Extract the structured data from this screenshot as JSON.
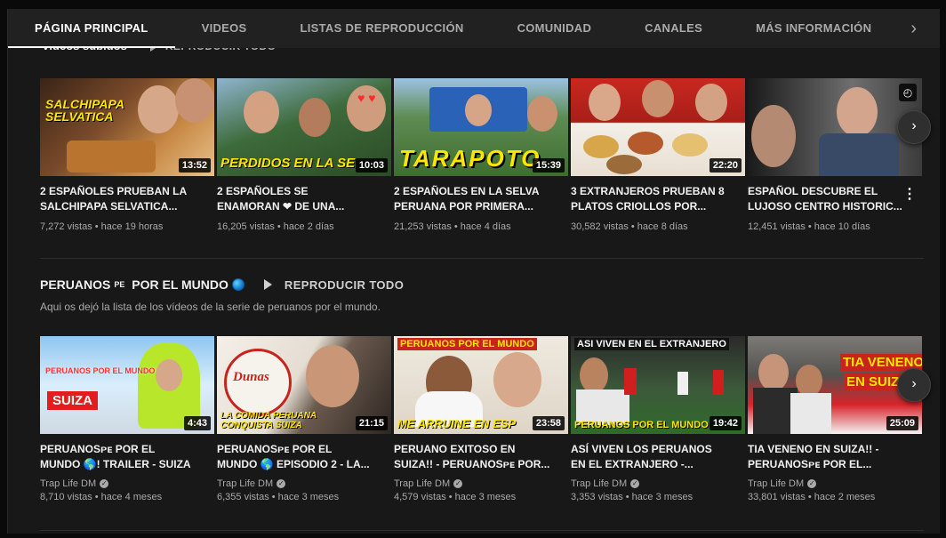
{
  "tabs": [
    {
      "label": "PÁGINA PRINCIPAL",
      "active": true
    },
    {
      "label": "VIDEOS"
    },
    {
      "label": "LISTAS DE REPRODUCCIÓN"
    },
    {
      "label": "COMUNIDAD"
    },
    {
      "label": "CANALES"
    },
    {
      "label": "MÁS INFORMACIÓN"
    }
  ],
  "tabs_next_icon": "chevron-right-icon",
  "section1": {
    "title": "Videos subidos",
    "play_all": "REPRODUCIR TODO",
    "videos": [
      {
        "title_line1": "2 ESPAÑOLES PRUEBAN LA",
        "title_line2": "SALCHIPAPA SELVATICA...",
        "meta": "7,272 vistas • hace 19 horas",
        "duration": "13:52",
        "overlay": "SALCHIPAPA SELVATICA"
      },
      {
        "title_line1": "2 ESPAÑOLES SE",
        "title_line2": "ENAMORAN ❤ DE UNA...",
        "meta": "16,205 vistas • hace 2 días",
        "duration": "10:03",
        "overlay": "PERDIDOS EN LA SE"
      },
      {
        "title_line1": "2 ESPAÑOLES EN LA SELVA",
        "title_line2": "PERUANA POR PRIMERA...",
        "meta": "21,253 vistas • hace 4 días",
        "duration": "15:39",
        "overlay": "TARAPOTO"
      },
      {
        "title_line1": "3 EXTRANJEROS PRUEBAN 8",
        "title_line2": "PLATOS CRIOLLOS POR...",
        "meta": "30,582 vistas • hace 8 días",
        "duration": "22:20",
        "overlay": ""
      },
      {
        "title_line1": "ESPAÑOL DESCUBRE EL",
        "title_line2": "LUJOSO CENTRO HISTORIC...",
        "meta": "12,451 vistas • hace 10 días",
        "duration": "",
        "overlay": ""
      }
    ]
  },
  "section2": {
    "title_main": "PERUANOS",
    "title_small": "PE",
    "title_rest": " POR EL MUNDO",
    "play_all": "REPRODUCIR TODO",
    "description": "Aqui os dejó la lista de los vídeos de la serie de peruanos por el mundo.",
    "videos": [
      {
        "title_line1": "PERUANOSᴘᴇ POR EL",
        "title_line2": "MUNDO 🌎! TRAILER - SUIZA",
        "channel": "Trap Life DM",
        "meta": "8,710 vistas • hace 4 meses",
        "duration": "4:43",
        "overlay1": "PERUANOS POR EL MUNDO",
        "overlay2": "SUIZA"
      },
      {
        "title_line1": "PERUANOSᴘᴇ POR EL",
        "title_line2": "MUNDO 🌎 EPISODIO 2 - LA...",
        "channel": "Trap Life DM",
        "meta": "6,355 vistas • hace 3 meses",
        "duration": "21:15",
        "overlay1": "Dunas",
        "overlay2": "LA COMIDA PERUANA CONQUISTA SUIZA"
      },
      {
        "title_line1": "PERUANO EXITOSO EN",
        "title_line2": "SUIZA!! - PERUANOSᴘᴇ POR...",
        "channel": "Trap Life DM",
        "meta": "4,579 vistas • hace 3 meses",
        "duration": "23:58",
        "overlay1": "PERUANOS POR EL MUNDO",
        "overlay2": "ME ARRUINE EN ESP"
      },
      {
        "title_line1": "ASÍ VIVEN LOS PERUANOS",
        "title_line2": "EN EL EXTRANJERO -...",
        "channel": "Trap Life DM",
        "meta": "3,353 vistas • hace 3 meses",
        "duration": "19:42",
        "overlay1": "ASI VIVEN EN EL EXTRANJERO",
        "overlay2": "PERUANOS POR EL MUNDO"
      },
      {
        "title_line1": "TIA VENENO EN SUIZA!! -",
        "title_line2": "PERUANOSᴘᴇ POR EL...",
        "channel": "Trap Life DM",
        "meta": "33,801 vistas • hace 2 meses",
        "duration": "25:09",
        "overlay1": "TIA VENENO",
        "overlay2": "EN SUIZA"
      }
    ]
  }
}
